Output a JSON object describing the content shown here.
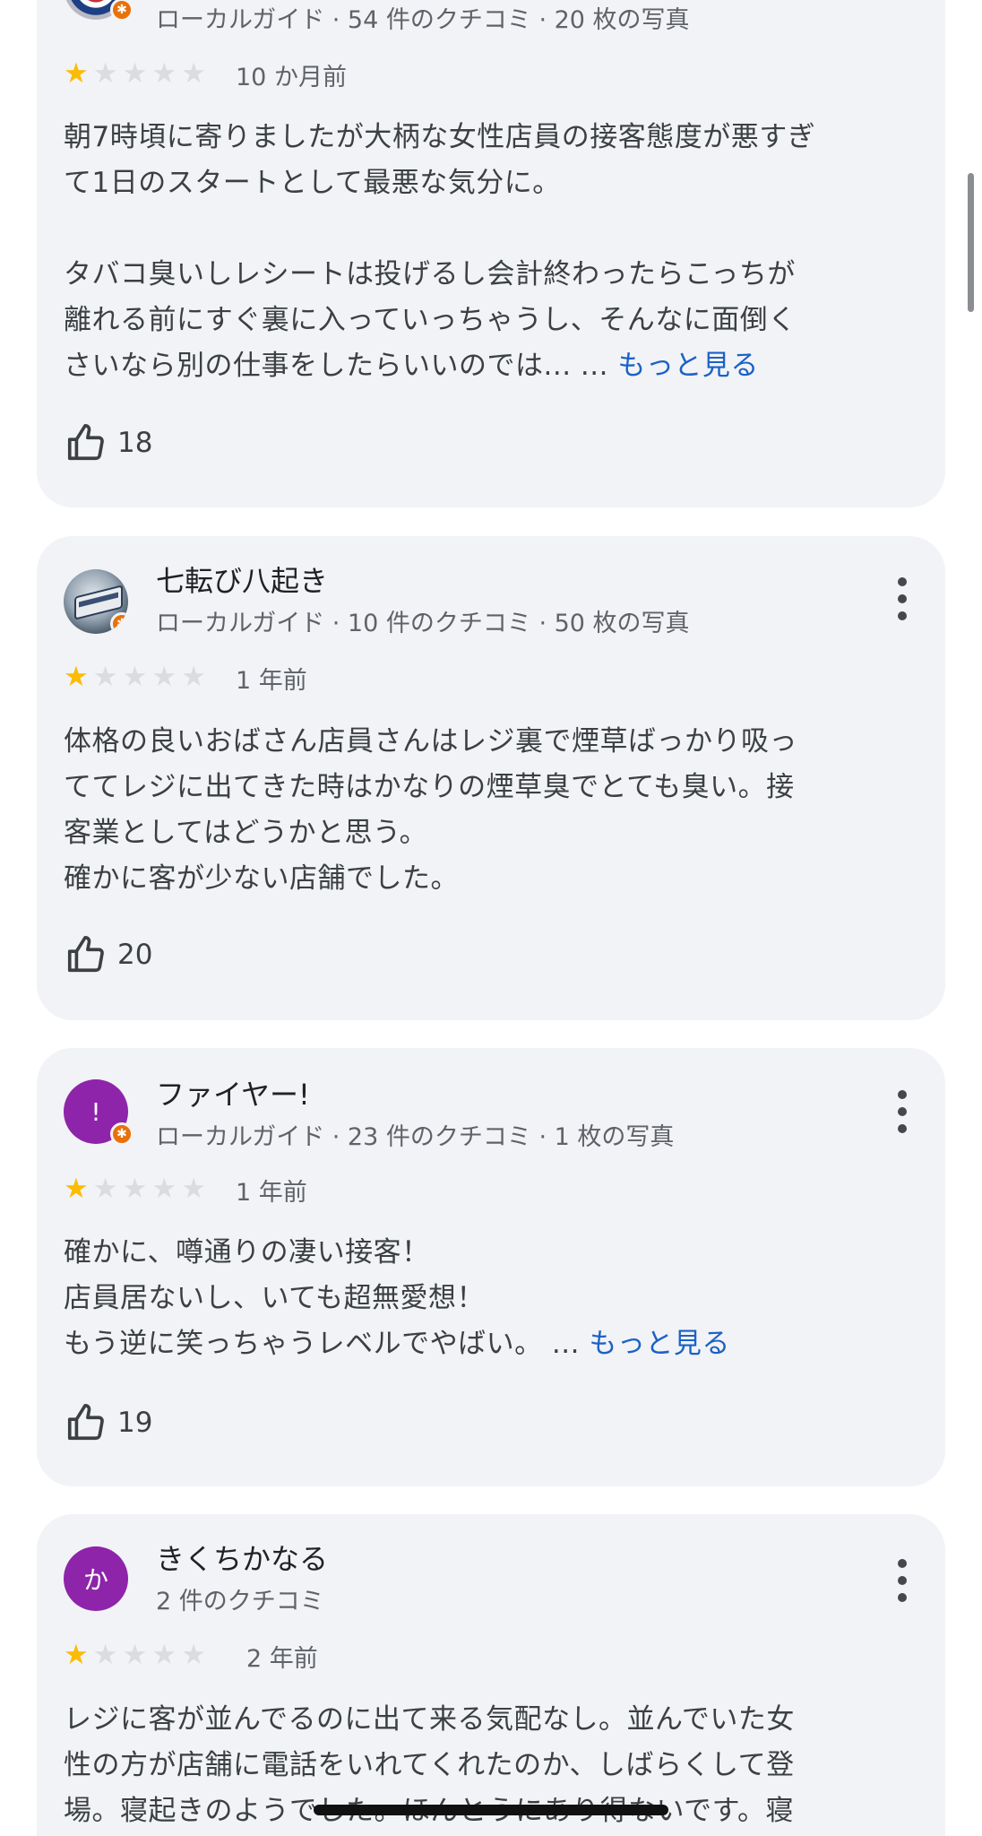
{
  "reviews": [
    {
      "author": "",
      "meta": "ローカルガイド · 54 件のクチコミ · 20 枚の写真",
      "rating": 1,
      "date": "10 か月前",
      "paragraphs": [
        "朝7時頃に寄りましたが大柄な女性店員の接客態度が悪すぎ",
        "て1日のスタートとして最悪な気分に。",
        "",
        "タバコ臭いしレシートは投げるし会計終わったらこっちが",
        "離れる前にすぐ裏に入っていっちゃうし、そんなに面倒く",
        "さいなら別の仕事をしたらいいのでは... ..."
      ],
      "more_label": "もっと見る",
      "likes": "18"
    },
    {
      "author": "七転び八起き",
      "meta": "ローカルガイド · 10 件のクチコミ · 50 枚の写真",
      "rating": 1,
      "date": "1 年前",
      "paragraphs": [
        "体格の良いおばさん店員さんはレジ裏で煙草ばっかり吸っ",
        "ててレジに出てきた時はかなりの煙草臭でとても臭い。接",
        "客業としてはどうかと思う。",
        "確かに客が少ない店舗でした。"
      ],
      "likes": "20"
    },
    {
      "author": "ファイヤー!",
      "avatar_letter": "!",
      "meta": "ローカルガイド · 23 件のクチコミ · 1 枚の写真",
      "rating": 1,
      "date": "1 年前",
      "paragraphs": [
        "確かに、噂通りの凄い接客！",
        "店員居ないし、いても超無愛想！",
        "もう逆に笑っちゃうレベルでやばい。 ..."
      ],
      "more_label": "もっと見る",
      "likes": "19"
    },
    {
      "author": "きくちかなる",
      "avatar_letter": "か",
      "meta": "2 件のクチコミ",
      "rating": 1,
      "date": "2 年前",
      "paragraphs": [
        "レジに客が並んでるのに出て来る気配なし。並んでいた女",
        "性の方が店舗に電話をいれてくれたのか、しばらくして登",
        "場。寝起きのようでした。ほんとうにあり得ないです。寝"
      ]
    }
  ],
  "icons": {
    "like": "thumbs-up-icon",
    "more": "more-vert-icon",
    "badge": "local-guide-badge-icon",
    "star": "star-icon"
  },
  "colors": {
    "card_background": "#f2f3f6",
    "star_filled": "#fbbc04",
    "star_empty": "#dadce0",
    "link": "#1a62c7",
    "avatar_purple": "#8e24aa",
    "badge_orange": "#e8710a"
  }
}
